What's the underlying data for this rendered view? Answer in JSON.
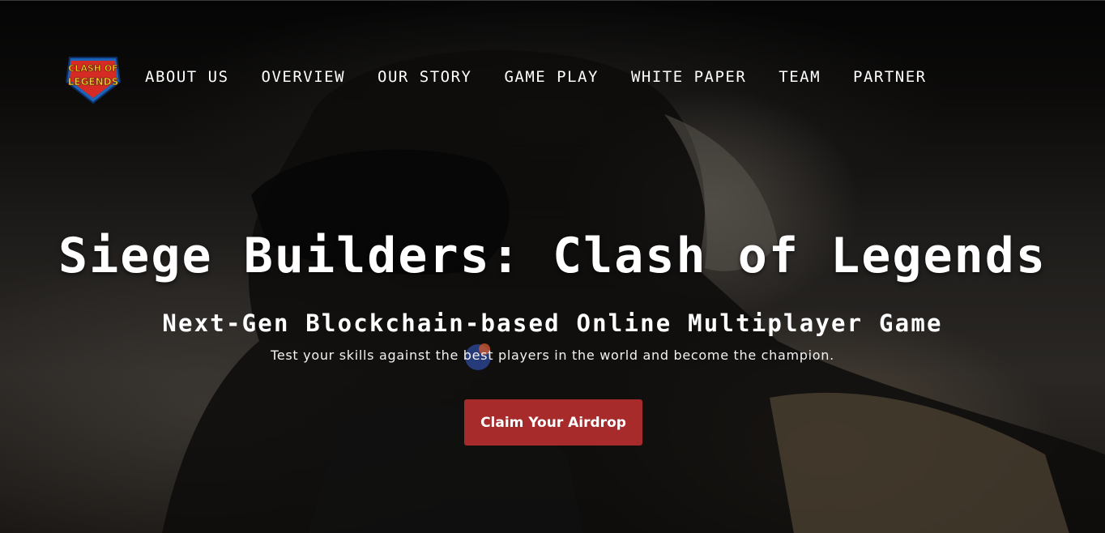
{
  "brand": {
    "logo_line1": "CLASH OF",
    "logo_line2": "LEGENDS"
  },
  "nav": {
    "items": [
      {
        "label": "ABOUT US"
      },
      {
        "label": "OVERVIEW"
      },
      {
        "label": "OUR STORY"
      },
      {
        "label": "GAME PLAY"
      },
      {
        "label": "WHITE PAPER"
      },
      {
        "label": "TEAM"
      },
      {
        "label": "PARTNER"
      }
    ]
  },
  "hero": {
    "title": "Siege Builders: Clash of Legends",
    "subtitle": "Next-Gen Blockchain-based Online Multiplayer Game",
    "tagline": "Test your skills against the best players in the world and become the champion.",
    "cta_label": "Claim Your Airdrop"
  },
  "colors": {
    "accent": "#a72b2b",
    "text": "#ffffff"
  }
}
